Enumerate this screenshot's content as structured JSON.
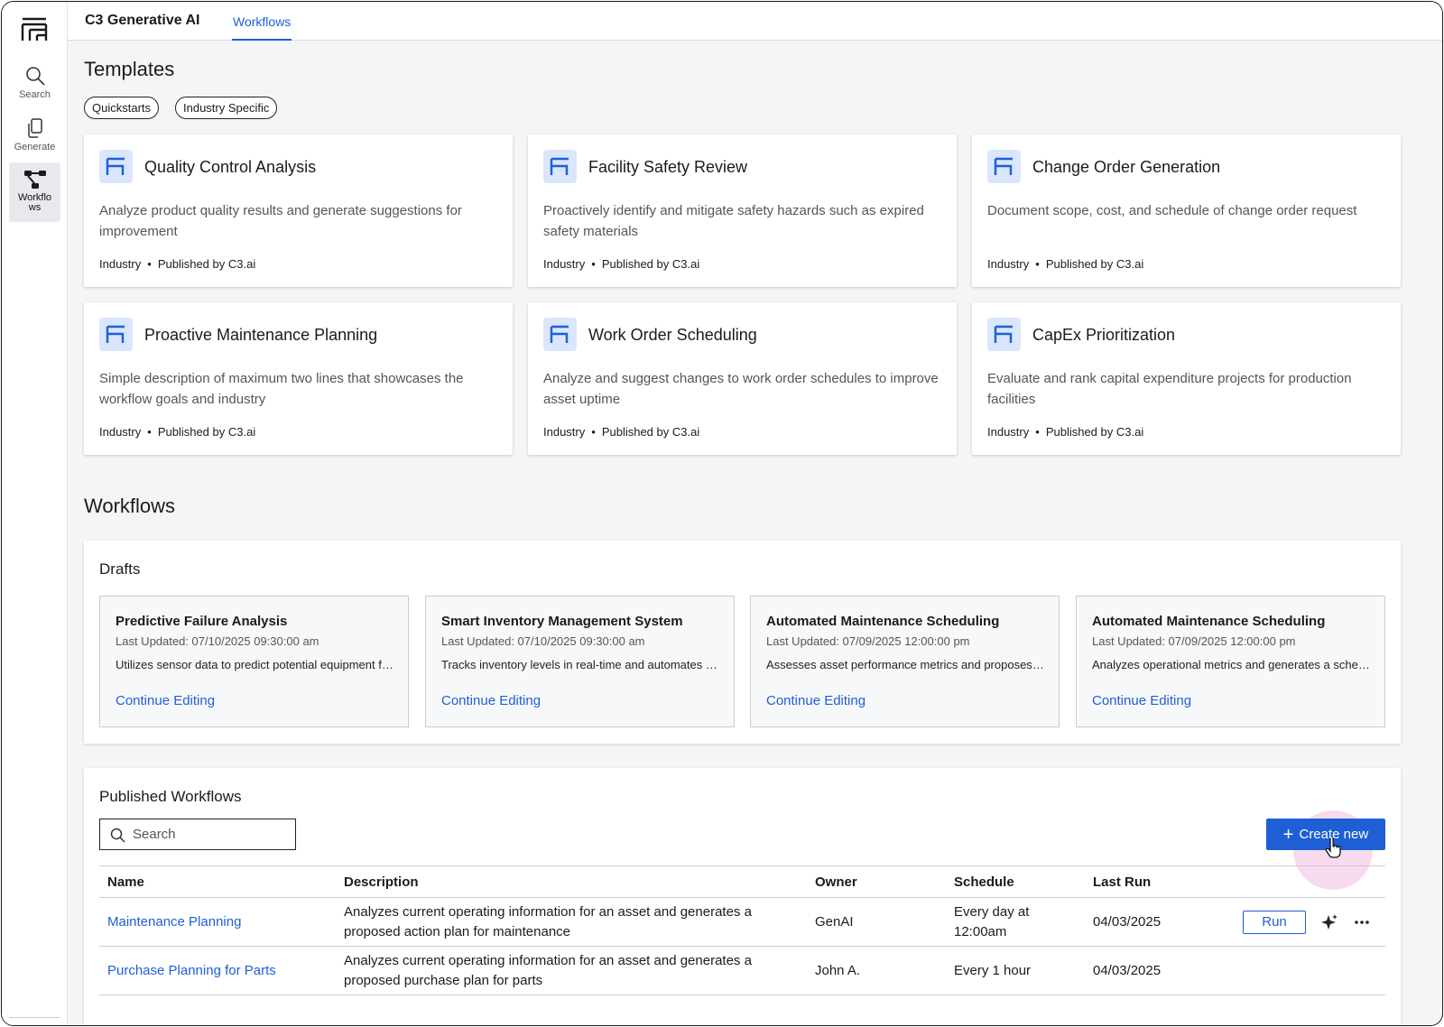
{
  "app": {
    "title": "C3 Generative AI",
    "active_tab": "Workflows"
  },
  "rail": {
    "items": [
      {
        "label": "Search",
        "icon": "search-icon"
      },
      {
        "label": "Generate",
        "icon": "copy-icon"
      },
      {
        "label": "Workflows",
        "icon": "workflow-icon",
        "active": true
      }
    ]
  },
  "templates": {
    "heading": "Templates",
    "chips": [
      "Quickstarts",
      "Industry Specific"
    ],
    "cards": [
      {
        "title": "Quality Control Analysis",
        "description": "Analyze product quality results and generate suggestions for improvement",
        "category": "Industry",
        "publisher": "Published by C3.ai"
      },
      {
        "title": "Facility Safety Review",
        "description": "Proactively identify and mitigate safety hazards such as expired safety materials",
        "category": "Industry",
        "publisher": "Published by C3.ai"
      },
      {
        "title": "Change Order Generation",
        "description": "Document scope, cost, and schedule of change order request",
        "category": "Industry",
        "publisher": "Published by C3.ai"
      },
      {
        "title": "Proactive Maintenance Planning",
        "description": "Simple description of maximum two lines that showcases the workflow goals and industry",
        "category": "Industry",
        "publisher": "Published by C3.ai"
      },
      {
        "title": "Work Order Scheduling",
        "description": "Analyze and suggest changes to work order schedules to improve asset uptime",
        "category": "Industry",
        "publisher": "Published by C3.ai"
      },
      {
        "title": "CapEx Prioritization",
        "description": "Evaluate and rank capital expenditure projects for production facilities",
        "category": "Industry",
        "publisher": "Published by C3.ai"
      }
    ]
  },
  "workflows": {
    "heading": "Workflows",
    "drafts": {
      "title": "Drafts",
      "link_label": "Continue Editing",
      "items": [
        {
          "title": "Predictive Failure Analysis",
          "updated": "Last Updated: 07/10/2025 09:30:00 am",
          "description": "Utilizes sensor data to predict potential equipment failures"
        },
        {
          "title": "Smart Inventory Management System",
          "updated": "Last Updated: 07/10/2025 09:30:00 am",
          "description": "Tracks inventory levels in real-time and automates reordering"
        },
        {
          "title": "Automated Maintenance Scheduling",
          "updated": "Last Updated: 07/09/2025 12:00:00 pm",
          "description": "Assesses asset performance metrics and proposes schedules"
        },
        {
          "title": "Automated Maintenance Scheduling",
          "updated": "Last Updated: 07/09/2025 12:00:00 pm",
          "description": "Analyzes operational metrics and generates a schedule"
        }
      ]
    },
    "published": {
      "title": "Published Workflows",
      "search_placeholder": "Search",
      "create_label": "Create new",
      "columns": [
        "Name",
        "Description",
        "Owner",
        "Schedule",
        "Last Run"
      ],
      "run_label": "Run",
      "rows": [
        {
          "name": "Maintenance Planning",
          "description": "Analyzes current operating information for an asset and generates a proposed action plan for maintenance",
          "owner": "GenAI",
          "schedule": "Every day at 12:00am",
          "last_run": "04/03/2025"
        },
        {
          "name": "Purchase Planning for Parts",
          "description": "Analyzes current operating information for an asset and generates a proposed purchase plan for parts",
          "owner": "John A.",
          "schedule": "Every 1 hour",
          "last_run": "04/03/2025"
        }
      ]
    }
  }
}
